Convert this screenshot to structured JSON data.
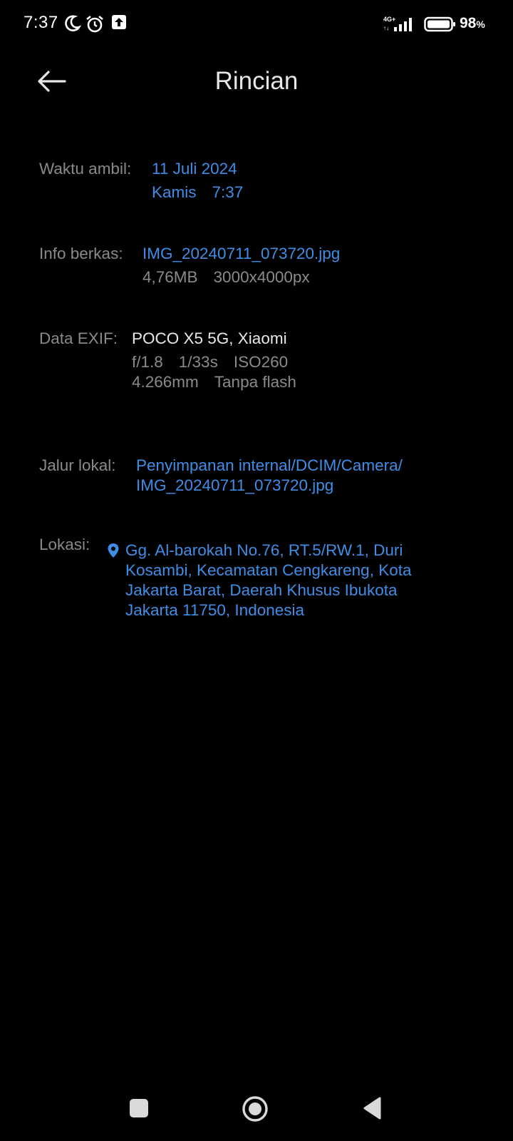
{
  "status_bar": {
    "time": "7:37",
    "network": "4G+",
    "battery_percent": "98",
    "battery_unit": "%",
    "icons": [
      "moon-icon",
      "alarm-icon",
      "upload-icon",
      "signal-icon",
      "battery-icon"
    ]
  },
  "header": {
    "title": "Rincian",
    "back_icon": "arrow-left-icon"
  },
  "details": {
    "taken": {
      "label": "Waktu ambil:",
      "date": "11 Juli 2024",
      "day": "Kamis",
      "time": "7:37"
    },
    "file": {
      "label": "Info berkas:",
      "name": "IMG_20240711_073720.jpg",
      "size": "4,76MB",
      "resolution": "3000x4000px"
    },
    "exif": {
      "label": "Data EXIF:",
      "device": "POCO X5 5G, Xiaomi",
      "aperture": "f/1.8",
      "shutter": "1/33s",
      "iso": "ISO260",
      "focal_length": "4.266mm",
      "flash": "Tanpa flash"
    },
    "path": {
      "label": "Jalur lokal:",
      "line1": "Penyimpanan internal/DCIM/Camera/",
      "line2": "IMG_20240711_073720.jpg"
    },
    "location": {
      "label": "Lokasi:",
      "icon": "location-pin-icon",
      "address": "Gg. Al-barokah No.76, RT.5/RW.1, Duri Kosambi, Kecamatan Cengkareng, Kota Jakarta Barat, Daerah Khusus Ibukota Jakarta 11750, Indonesia"
    }
  },
  "nav_bar": {
    "recent_icon": "square-icon",
    "home_icon": "circle-icon",
    "back_icon": "triangle-back-icon"
  },
  "colors": {
    "background": "#000000",
    "accent_blue": "#3f8de6",
    "label_gray": "#8a8a8a",
    "text_white": "#e9e9e9"
  }
}
